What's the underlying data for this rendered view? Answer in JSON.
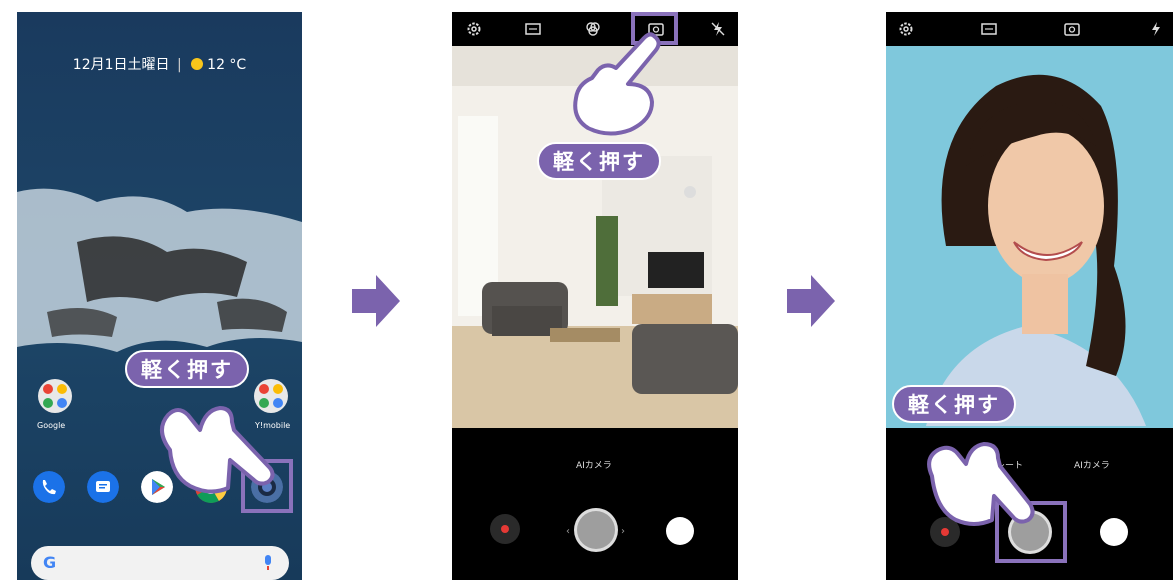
{
  "callout_text": "軽く押す",
  "phone1": {
    "date": "12月1日土曜日",
    "separator": "|",
    "temperature": "12 °C",
    "folder_left_label": "Google",
    "folder_right_label": "Y!mobile",
    "search_letter": "G"
  },
  "phone2": {
    "mode_label": "AIカメラ"
  },
  "phone3": {
    "mode_left": "レート",
    "mode_label": "AIカメラ"
  },
  "colors": {
    "accent": "#7b63ad",
    "highlight": "#8a72bb",
    "arrow": "#7b63ad"
  }
}
